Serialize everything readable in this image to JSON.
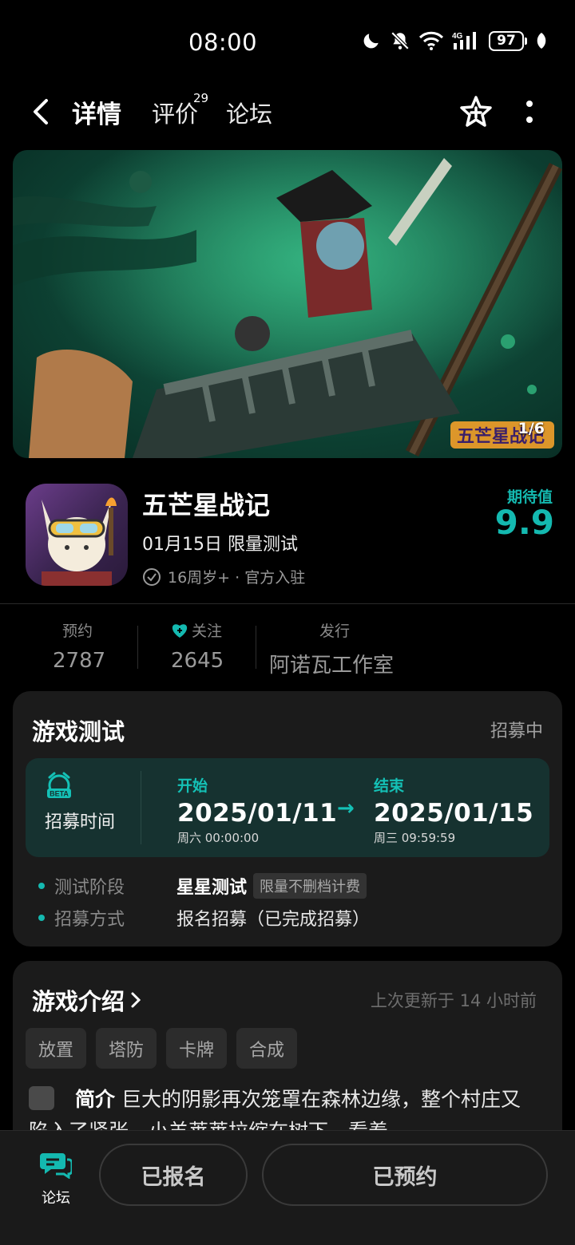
{
  "status_bar": {
    "time": "08:00",
    "battery": "97",
    "network": "4G",
    "icons": [
      "moon-icon",
      "mute-icon",
      "wifi-icon",
      "signal-icon",
      "battery-icon",
      "leaf-icon"
    ]
  },
  "nav": {
    "tabs": [
      {
        "label": "详情",
        "active": true
      },
      {
        "label": "评价",
        "count": "29"
      },
      {
        "label": "论坛"
      }
    ]
  },
  "hero": {
    "counter": "1/6",
    "logo_text": "五芒星战记"
  },
  "game": {
    "title": "五芒星战记",
    "date_status": "01月15日 限量测试",
    "meta": "16周岁+ · 官方入驻",
    "expect_label": "期待值",
    "expect_value": "9.9"
  },
  "stats": {
    "reserve": {
      "label": "预约",
      "value": "2787"
    },
    "follow": {
      "label": "关注",
      "value": "2645"
    },
    "publisher": {
      "label": "发行",
      "value": "阿诺瓦工作室"
    }
  },
  "test": {
    "title": "游戏测试",
    "status": "招募中",
    "recruit_label": "招募时间",
    "recruit_icon_text": "BETA",
    "start": {
      "head": "开始",
      "date": "2025/01/11",
      "sub": "周六 00:00:00"
    },
    "end": {
      "head": "结束",
      "date": "2025/01/15",
      "sub": "周三 09:59:59"
    },
    "arrow": "→",
    "stage": {
      "key": "测试阶段",
      "value": "星星测试",
      "tag": "限量不删档计费"
    },
    "method": {
      "key": "招募方式",
      "value": "报名招募（已完成招募）"
    }
  },
  "intro": {
    "title": "游戏介绍",
    "updated": "上次更新于 14 小时前",
    "tags": [
      "放置",
      "塔防",
      "卡牌",
      "合成"
    ],
    "label": "简介",
    "text": "巨大的阴影再次笼罩在森林边缘，整个村庄又陷入了紧张。小羊莱莱拉缩在树下，看着"
  },
  "bottom": {
    "forum_label": "论坛",
    "signed_label": "已报名",
    "reserved_label": "已预约"
  },
  "colors": {
    "accent": "#14b9b0",
    "background": "#000000",
    "card": "#1b1b1b"
  }
}
